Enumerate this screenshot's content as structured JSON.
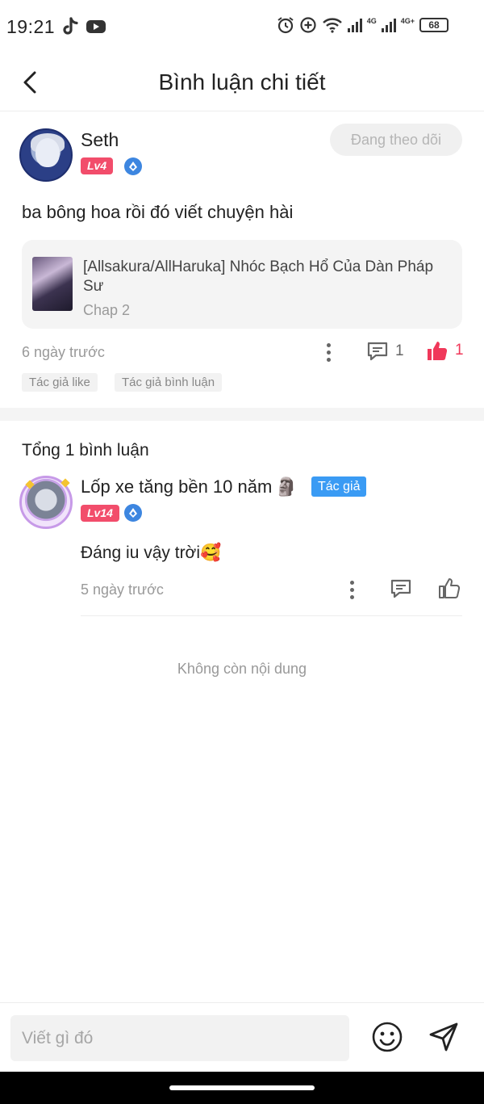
{
  "status_bar": {
    "time": "19:21",
    "network_1": "4G",
    "network_2": "4G+",
    "battery": "68"
  },
  "header": {
    "title": "Bình luận chi tiết"
  },
  "post": {
    "username": "Seth",
    "level": "Lv4",
    "follow_label": "Đang theo dõi",
    "text": "ba bông hoa rồi đó viết chuyện hài",
    "work": {
      "title": "[Allsakura/AllHaruka] Nhóc Bạch Hổ Của Dàn Pháp Sư",
      "chapter": "Chap 2"
    },
    "time": "6 ngày trước",
    "comment_count": "1",
    "like_count": "1",
    "tags": [
      "Tác giả like",
      "Tác giả bình luận"
    ]
  },
  "comments_section": {
    "total": "Tổng 1 bình luận",
    "items": [
      {
        "username": "Lốp xe tăng bền 10 năm",
        "username_emoji": "🗿",
        "level": "Lv14",
        "badge": "Tác giả",
        "text": "Đáng iu vậy trời🥰",
        "time": "5 ngày trước"
      }
    ],
    "end_text": "Không còn nội dung"
  },
  "input": {
    "placeholder": "Viết gì đó"
  },
  "colors": {
    "level_badge": "#f24d6b",
    "like_active": "#f0385a",
    "author_badge": "#3a9bf4",
    "gem_badge": "#3d86e0"
  },
  "icons": {
    "back": "chevron-left-icon",
    "comment": "comment-icon",
    "like_filled": "thumbs-up-filled-icon",
    "like": "thumbs-up-icon",
    "more": "more-vertical-icon",
    "emoji": "smiley-icon",
    "send": "send-icon"
  }
}
